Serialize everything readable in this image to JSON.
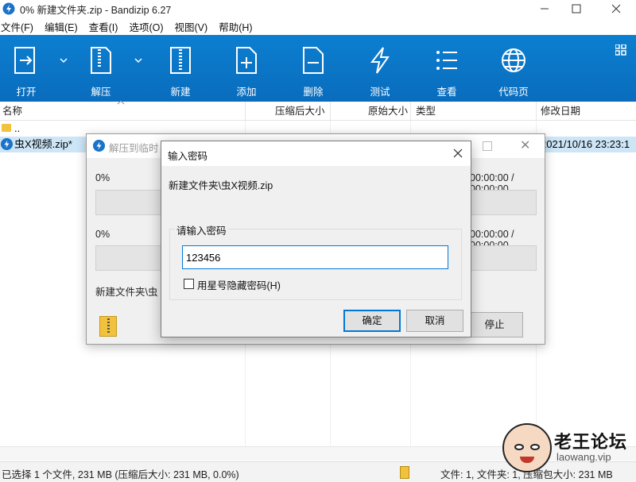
{
  "window": {
    "title": "0% 新建文件夹.zip - Bandizip 6.27",
    "controls": [
      "minimize",
      "maximize",
      "close"
    ]
  },
  "menu": [
    "文件(F)",
    "编辑(E)",
    "查看(I)",
    "选项(O)",
    "视图(V)",
    "帮助(H)"
  ],
  "toolbar": {
    "buttons": [
      {
        "label": "打开",
        "icon": "open-icon"
      },
      {
        "label": "解压",
        "icon": "extract-icon"
      },
      {
        "label": "新建",
        "icon": "new-archive-icon"
      },
      {
        "label": "添加",
        "icon": "add-file-icon"
      },
      {
        "label": "删除",
        "icon": "delete-file-icon"
      },
      {
        "label": "测试",
        "icon": "test-icon"
      },
      {
        "label": "查看",
        "icon": "view-icon"
      },
      {
        "label": "代码页",
        "icon": "codepage-icon"
      }
    ],
    "colors": {
      "background": "#0c7fd0",
      "text": "#ffffff"
    }
  },
  "columns": [
    "名称",
    "压缩后大小",
    "原始大小",
    "类型",
    "修改日期"
  ],
  "files": [
    {
      "name": "..",
      "date": "",
      "type": "folder"
    },
    {
      "name": "虫X视频.zip*",
      "date": "2021/10/16 23:23:1",
      "type": "zip",
      "selected": true
    }
  ],
  "status": {
    "left": "已选择 1 个文件, 231 MB (压缩后大小: 231 MB, 0.0%)",
    "right": "文件: 1, 文件夹: 1, 压缩包大小: 231 MB"
  },
  "extract_dialog": {
    "title": "解压到临时",
    "progress1": "0%",
    "time1": "00:00:00 / 00:00:00",
    "progress2": "0%",
    "time2": "00:00:00 / 00:00:00",
    "path": "新建文件夹\\虫",
    "stop_label": "停止"
  },
  "password_dialog": {
    "title": "输入密码",
    "path": "新建文件夹\\虫X视频.zip",
    "group_label": "请输入密码",
    "password_value": "123456",
    "hide_label": "用星号隐藏密码(H)",
    "hide_checked": false,
    "ok_label": "确定",
    "cancel_label": "取消"
  },
  "watermark": {
    "brand": "老王论坛",
    "url": "laowang.vip"
  }
}
